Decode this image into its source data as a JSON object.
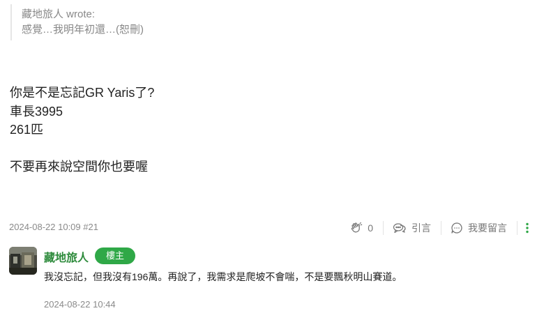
{
  "quote": {
    "author": "藏地旅人 wrote:",
    "text": "感覺…我明年初還…(恕刪)"
  },
  "post": {
    "lines": [
      "你是不是忘記GR Yaris了?",
      "車長3995",
      "261匹",
      "",
      "不要再來說空間你也要喔"
    ],
    "meta": "2024-08-22 10:09 #21",
    "actions": {
      "likes": "0",
      "quote_label": "引言",
      "comment_label": "我要留言"
    }
  },
  "reply": {
    "author": "藏地旅人",
    "badge": "樓主",
    "text": "我沒忘記，但我沒有196萬。再說了，我需求是爬坡不會喘，不是要飄秋明山賽道。",
    "time": "2024-08-22 10:44"
  },
  "colors": {
    "accent_green": "#2fa847",
    "name_green": "#2e8b3c",
    "muted_text": "#8a8a8a"
  },
  "icons": [
    "clap-icon",
    "quote-chat-icon",
    "comment-bubble-icon",
    "more-vertical-icon"
  ]
}
